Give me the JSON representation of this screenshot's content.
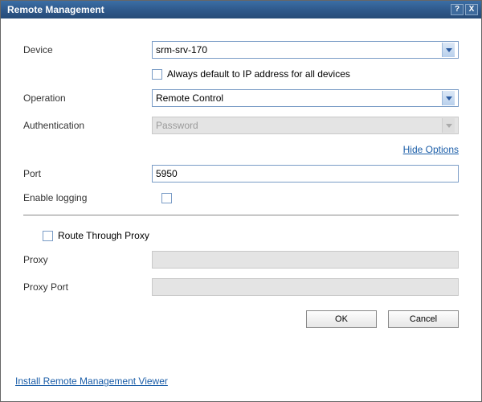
{
  "titlebar": {
    "title": "Remote Management",
    "help": "?",
    "close": "X"
  },
  "labels": {
    "device": "Device",
    "operation": "Operation",
    "authentication": "Authentication",
    "port": "Port",
    "enable_logging": "Enable logging",
    "route_through_proxy": "Route Through Proxy",
    "proxy": "Proxy",
    "proxy_port": "Proxy Port"
  },
  "values": {
    "device": "srm-srv-170",
    "operation": "Remote Control",
    "authentication": "Password",
    "port": "5950",
    "proxy": "",
    "proxy_port": ""
  },
  "checkboxes": {
    "always_default_ip": "Always default to IP address for all devices"
  },
  "links": {
    "hide_options": "Hide Options",
    "install_viewer": "Install Remote Management Viewer"
  },
  "buttons": {
    "ok": "OK",
    "cancel": "Cancel"
  }
}
